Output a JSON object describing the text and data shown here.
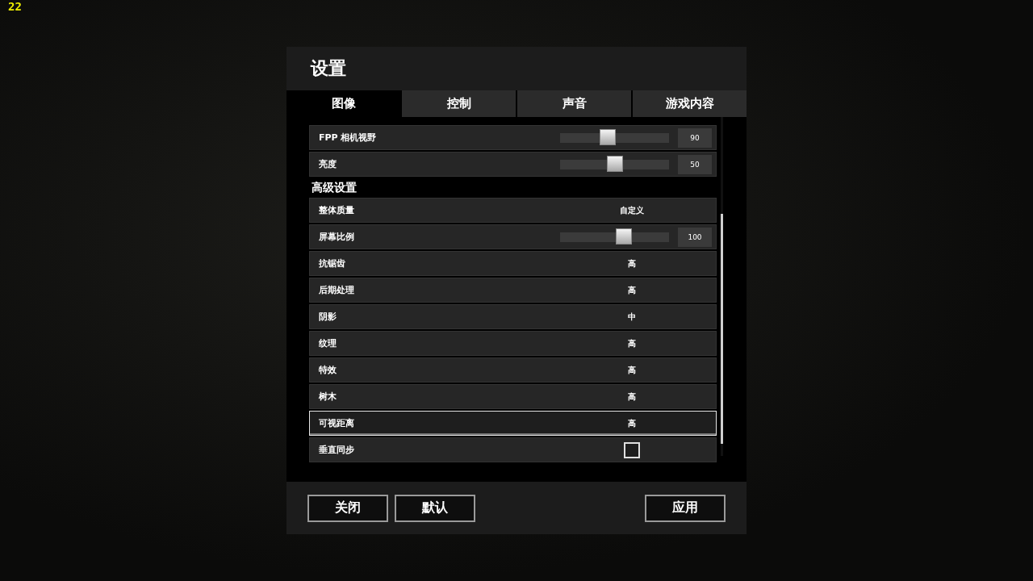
{
  "fps_counter": "22",
  "dialog": {
    "title": "设置",
    "tabs": [
      {
        "label": "图像",
        "selected": true
      },
      {
        "label": "控制",
        "selected": false
      },
      {
        "label": "声音",
        "selected": false
      },
      {
        "label": "游戏内容",
        "selected": false
      }
    ],
    "rows": [
      {
        "kind": "slider",
        "label": "FPP 相机视野",
        "level": 0.43,
        "reading": "90",
        "focused": false
      },
      {
        "kind": "slider",
        "label": "亮度",
        "level": 0.5,
        "reading": "50",
        "focused": false
      },
      {
        "kind": "heading",
        "label": "高级设置"
      },
      {
        "kind": "value",
        "label": "整体质量",
        "value": "自定义",
        "focused": false
      },
      {
        "kind": "slider",
        "label": "屏幕比例",
        "level": 0.6,
        "reading": "100",
        "focused": false
      },
      {
        "kind": "value",
        "label": "抗锯齿",
        "value": "高",
        "focused": false
      },
      {
        "kind": "value",
        "label": "后期处理",
        "value": "高",
        "focused": false
      },
      {
        "kind": "value",
        "label": "阴影",
        "value": "中",
        "focused": false
      },
      {
        "kind": "value",
        "label": "纹理",
        "value": "高",
        "focused": false
      },
      {
        "kind": "value",
        "label": "特效",
        "value": "高",
        "focused": false
      },
      {
        "kind": "value",
        "label": "树木",
        "value": "高",
        "focused": false
      },
      {
        "kind": "value",
        "label": "可视距离",
        "value": "高",
        "focused": true
      },
      {
        "kind": "checkbox",
        "label": "垂直同步",
        "checked": false,
        "focused": false
      }
    ],
    "left_buttons": [
      "关闭",
      "默认"
    ],
    "right_buttons": [
      "应用"
    ]
  }
}
